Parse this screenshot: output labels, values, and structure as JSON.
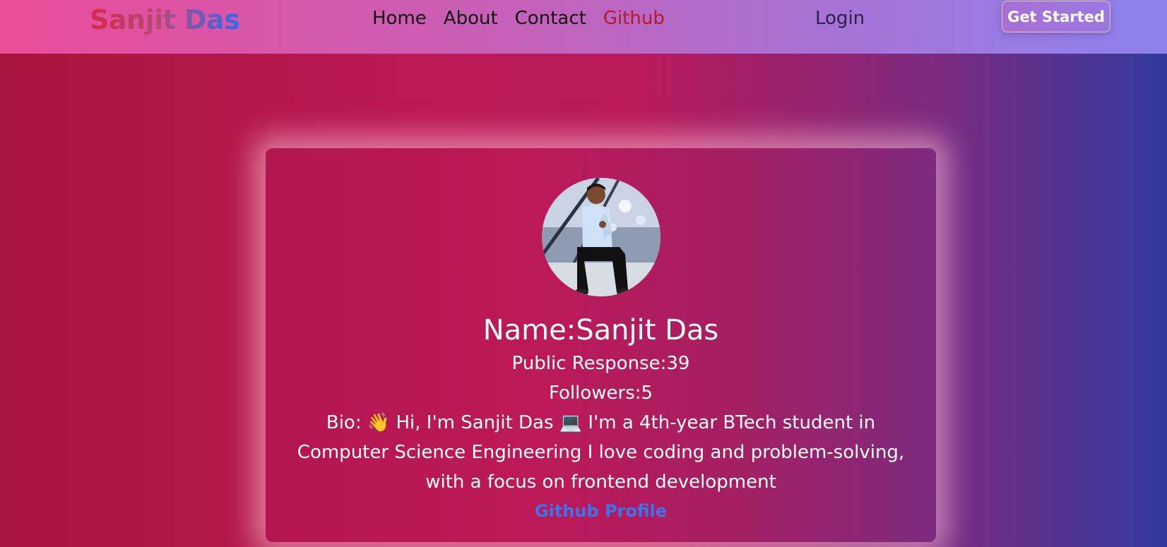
{
  "navbar": {
    "brand": "Sanjit Das",
    "links": [
      {
        "label": "Home"
      },
      {
        "label": "About"
      },
      {
        "label": "Contact"
      },
      {
        "label": "Github"
      }
    ],
    "login_label": "Login",
    "cta_label": "Get Started"
  },
  "profile": {
    "name_text": "Name:Sanjit Das",
    "public_response_text": "Public Response:39",
    "followers_text": "Followers:5",
    "bio_text": "Bio: 👋 Hi, I'm Sanjit Das 💻 I'm a 4th-year BTech student in Computer Science Engineering I love coding and problem-solving, with a focus on frontend development",
    "github_link_label": "Github Profile"
  },
  "colors": {
    "active_nav": "#b01b2e",
    "link_blue": "#3d73ee"
  }
}
